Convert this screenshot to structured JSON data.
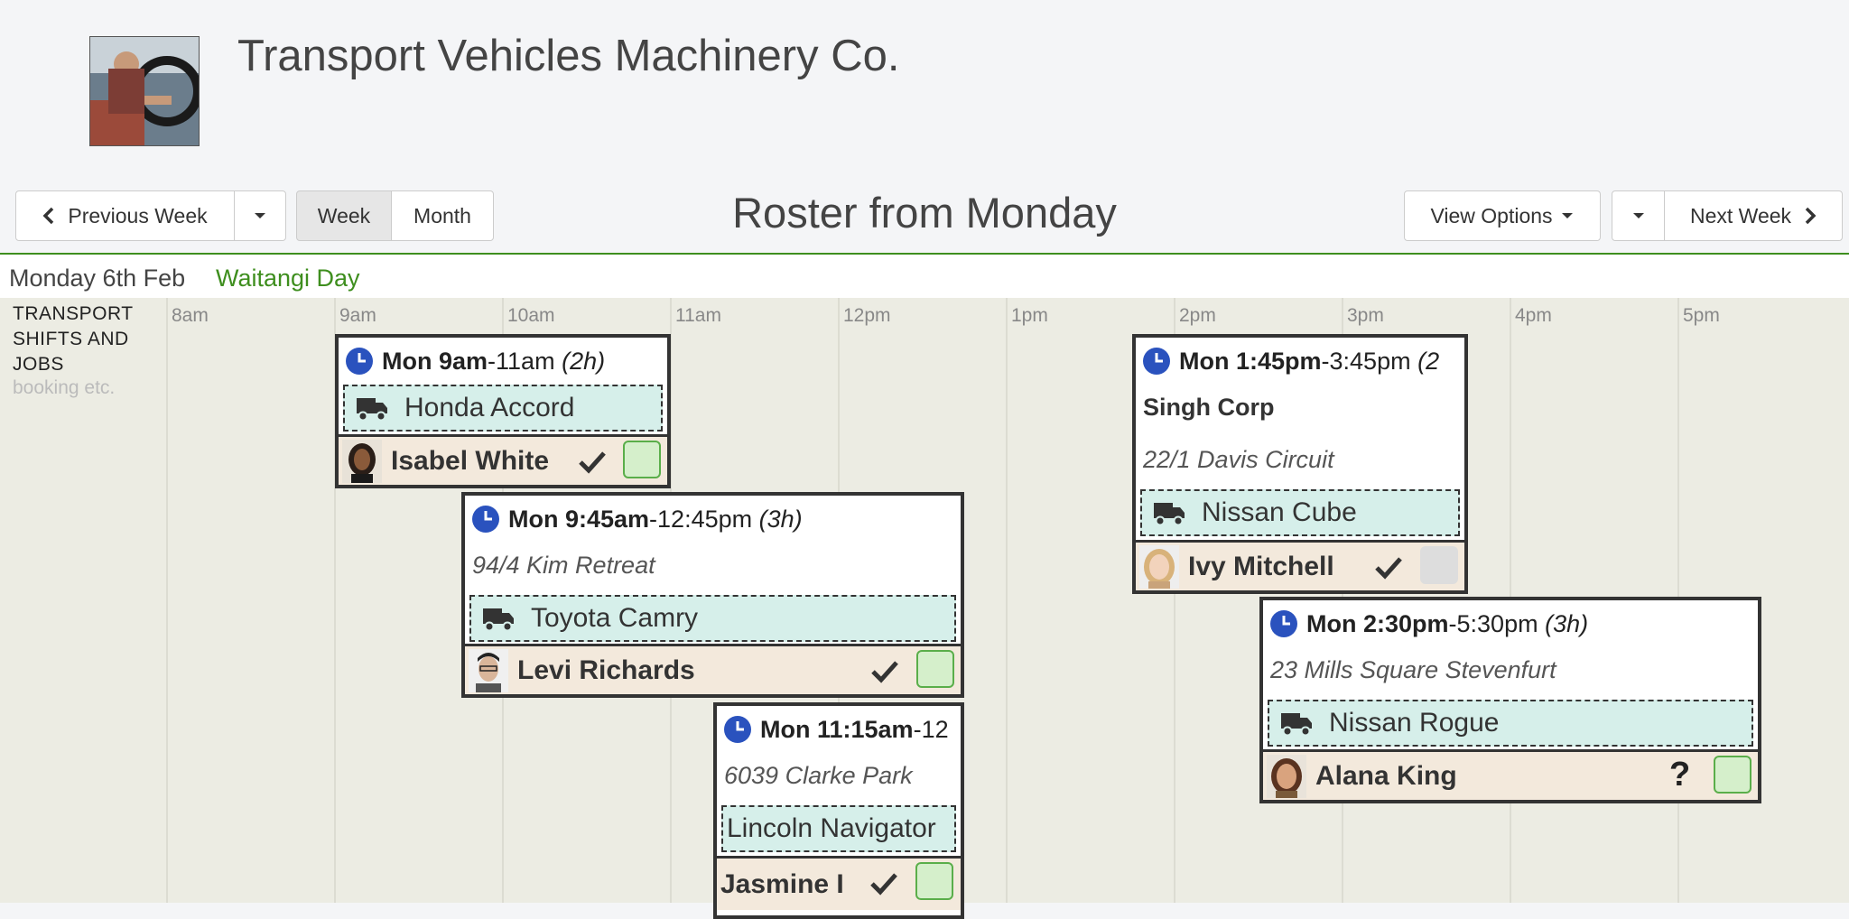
{
  "company": {
    "name": "Transport Vehicles Machinery Co."
  },
  "toolbar": {
    "prev_week": "Previous Week",
    "week": "Week",
    "month": "Month",
    "title": "Roster from Monday",
    "view_options": "View Options",
    "next_week": "Next Week"
  },
  "day": {
    "label": "Monday 6th Feb",
    "holiday": "Waitangi Day"
  },
  "side": {
    "title_lines": [
      "TRANSPORT",
      "SHIFTS AND",
      "JOBS"
    ],
    "subtitle": "booking etc."
  },
  "times": [
    "8am",
    "9am",
    "10am",
    "11am",
    "12pm",
    "1pm",
    "2pm",
    "3pm",
    "4pm",
    "5pm"
  ],
  "shifts": [
    {
      "start": "Mon 9am",
      "end": "-11am",
      "duration": "(2h)",
      "client": "",
      "address": "",
      "vehicle": "Honda Accord",
      "staff": "Isabel White",
      "status": "confirmed",
      "box": "green"
    },
    {
      "start": "Mon 9:45am",
      "end": "-12:45pm",
      "duration": "(3h)",
      "client": "",
      "address": "94/4 Kim Retreat",
      "vehicle": "Toyota Camry",
      "staff": "Levi Richards",
      "status": "confirmed",
      "box": "green"
    },
    {
      "start": "Mon 11:15am",
      "end": "-12",
      "duration": "",
      "client": "",
      "address": "6039 Clarke Park",
      "vehicle": "Lincoln Navigator",
      "staff": "Jasmine I",
      "status": "confirmed",
      "box": "green"
    },
    {
      "start": "Mon 1:45pm",
      "end": "-3:45pm",
      "duration": "(2",
      "client": "Singh Corp",
      "address": "22/1 Davis Circuit",
      "vehicle": "Nissan Cube",
      "staff": "Ivy Mitchell",
      "status": "confirmed",
      "box": "grey"
    },
    {
      "start": "Mon 2:30pm",
      "end": "-5:30pm",
      "duration": "(3h)",
      "client": "",
      "address": "23 Mills Square Stevenfurt",
      "vehicle": "Nissan Rogue",
      "staff": "Alana King",
      "status": "?",
      "box": "green"
    }
  ],
  "colors": {
    "accent_green": "#3e8e1e",
    "clock_blue": "#2a52be",
    "vehicle_bg": "#d6efea",
    "staff_bg": "#f3e9dc"
  },
  "icons": [
    "clock-icon",
    "truck-icon",
    "check-icon",
    "chevron-left-icon",
    "chevron-right-icon",
    "caret-down-icon"
  ]
}
